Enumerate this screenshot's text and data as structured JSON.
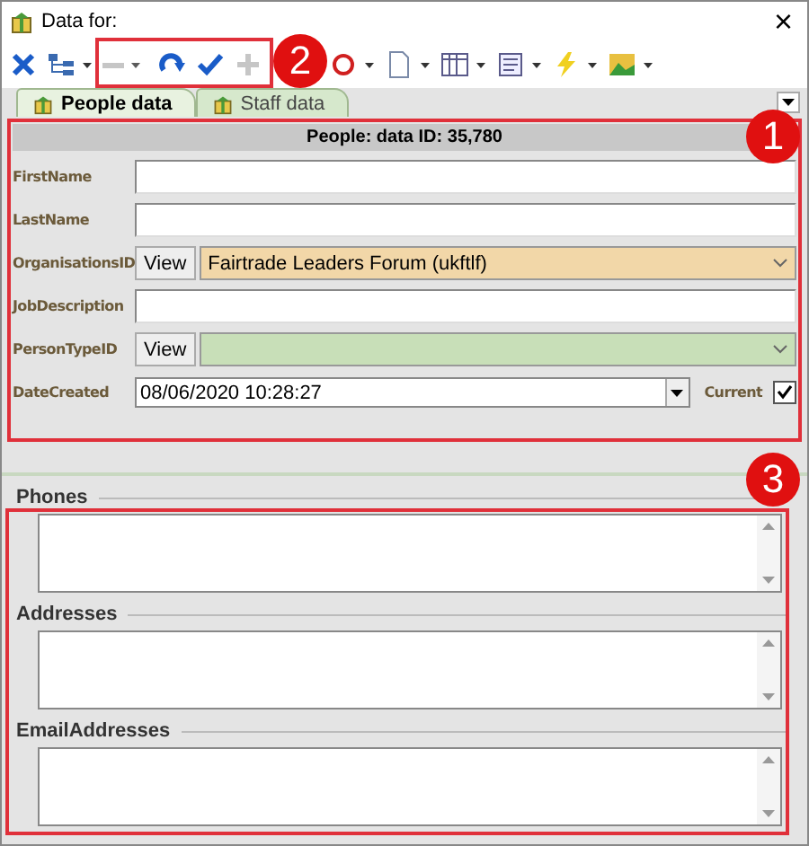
{
  "window": {
    "title": "Data for:",
    "close": "×"
  },
  "toolbar": [
    {
      "kind": "close",
      "disabled": false,
      "dropdown": false
    },
    {
      "kind": "tree",
      "disabled": false,
      "dropdown": true
    },
    {
      "kind": "minus",
      "disabled": true,
      "dropdown": true
    },
    {
      "kind": "redo",
      "disabled": false,
      "dropdown": false
    },
    {
      "kind": "check",
      "disabled": false,
      "dropdown": false
    },
    {
      "kind": "plus",
      "disabled": true,
      "dropdown": false
    },
    {
      "kind": "refresh",
      "disabled": false,
      "dropdown": true
    },
    {
      "kind": "document",
      "disabled": false,
      "dropdown": true
    },
    {
      "kind": "grid",
      "disabled": false,
      "dropdown": true
    },
    {
      "kind": "form",
      "disabled": false,
      "dropdown": true
    },
    {
      "kind": "lightning",
      "disabled": false,
      "dropdown": true
    },
    {
      "kind": "image",
      "disabled": false,
      "dropdown": true
    }
  ],
  "tabs": [
    {
      "label": "People data",
      "selected": true
    },
    {
      "label": "Staff data",
      "selected": false
    }
  ],
  "form": {
    "header": "People: data ID: 35,780",
    "fields": [
      {
        "kind": "text",
        "label": "FirstName"
      },
      {
        "kind": "text",
        "label": "LastName"
      },
      {
        "kind": "lookup",
        "label": "OrganisationsID",
        "button": "View",
        "value": "Fairtrade Leaders Forum (ukftlf)",
        "color": "#f2d7a8"
      },
      {
        "kind": "text",
        "label": "JobDescription"
      },
      {
        "kind": "lookup",
        "label": "PersonTypeID",
        "button": "View",
        "color": "#c8dfb8"
      },
      {
        "kind": "datetime",
        "label": "DateCreated",
        "value": "08/06/2020 10:28:27",
        "check_label": "Current",
        "checked": true
      }
    ]
  },
  "sections": [
    {
      "title": "Phones"
    },
    {
      "title": "Addresses"
    },
    {
      "title": "EmailAddresses"
    }
  ],
  "annotations": [
    {
      "number": "1",
      "kind": "form"
    },
    {
      "number": "2",
      "kind": "toolbar"
    },
    {
      "number": "3",
      "kind": "sections"
    }
  ]
}
